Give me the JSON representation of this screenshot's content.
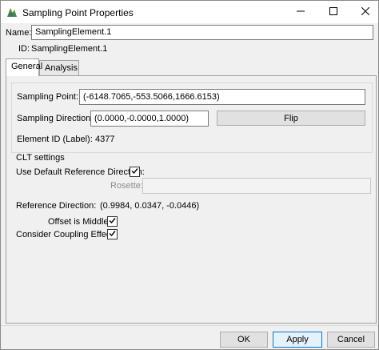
{
  "window": {
    "title": "Sampling Point Properties",
    "icons": {
      "app": "app-logo-icon",
      "minimize": "minimize-icon",
      "maximize": "maximize-icon",
      "close": "close-icon"
    }
  },
  "header": {
    "name_label": "Name:",
    "name_value": "SamplingElement.1",
    "id_label": "ID:",
    "id_value": "SamplingElement.1"
  },
  "tabs": [
    {
      "label": "General",
      "active": true
    },
    {
      "label": "Analysis",
      "active": false
    }
  ],
  "general": {
    "sampling_point_label": "Sampling Point:",
    "sampling_point_value": "(-6148.7065,-553.5066,1666.6153)",
    "sampling_direction_label": "Sampling Direction:",
    "sampling_direction_value": "(0.0000,-0.0000,1.0000)",
    "flip_label": "Flip",
    "element_id_label": "Element ID (Label):",
    "element_id_value": "4377"
  },
  "clt": {
    "title": "CLT settings",
    "use_default_ref_label": "Use Default Reference Direction:",
    "use_default_ref_checked": true,
    "rosette_label": "Rosette:",
    "rosette_value": "",
    "reference_direction_label": "Reference Direction:",
    "reference_direction_value": "(0.9984, 0.0347, -0.0446)",
    "offset_middle_label": "Offset is Middle:",
    "offset_middle_checked": true,
    "coupling_label": "Consider Coupling Effect:",
    "coupling_checked": true
  },
  "footer": {
    "ok_label": "OK",
    "apply_label": "Apply",
    "cancel_label": "Cancel"
  },
  "colors": {
    "window_bg": "#f0f0f0",
    "accent_border": "#0078d7",
    "disabled_text": "#8d8d8d"
  }
}
